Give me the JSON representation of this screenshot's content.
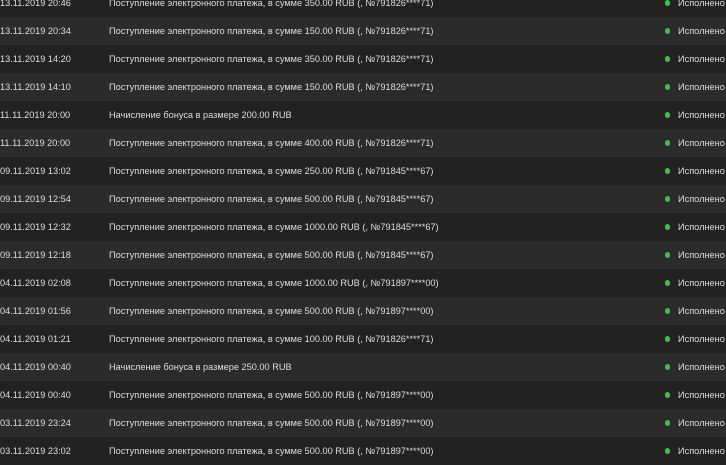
{
  "transactions": [
    {
      "date": "13.11.2019 20:46",
      "description": "Поступление электронного платежа, в сумме 350.00 RUB (, №791826****71)",
      "status": "Исполнено"
    },
    {
      "date": "13.11.2019 20:34",
      "description": "Поступление электронного платежа, в сумме 150.00 RUB (, №791826****71)",
      "status": "Исполнено"
    },
    {
      "date": "13.11.2019 14:20",
      "description": "Поступление электронного платежа, в сумме 350.00 RUB (, №791826****71)",
      "status": "Исполнено"
    },
    {
      "date": "13.11.2019 14:10",
      "description": "Поступление электронного платежа, в сумме 150.00 RUB (, №791826****71)",
      "status": "Исполнено"
    },
    {
      "date": "11.11.2019 20:00",
      "description": "Начисление бонуса в размере 200.00 RUB",
      "status": "Исполнено"
    },
    {
      "date": "11.11.2019 20:00",
      "description": "Поступление электронного платежа, в сумме 400.00 RUB (, №791826****71)",
      "status": "Исполнено"
    },
    {
      "date": "09.11.2019 13:02",
      "description": "Поступление электронного платежа, в сумме 250.00 RUB (, №791845****67)",
      "status": "Исполнено"
    },
    {
      "date": "09.11.2019 12:54",
      "description": "Поступление электронного платежа, в сумме 500.00 RUB (, №791845****67)",
      "status": "Исполнено"
    },
    {
      "date": "09.11.2019 12:32",
      "description": "Поступление электронного платежа, в сумме 1000.00 RUB (, №791845****67)",
      "status": "Исполнено"
    },
    {
      "date": "09.11.2019 12:18",
      "description": "Поступление электронного платежа, в сумме 500.00 RUB (, №791845****67)",
      "status": "Исполнено"
    },
    {
      "date": "04.11.2019 02:08",
      "description": "Поступление электронного платежа, в сумме 1000.00 RUB (, №791897****00)",
      "status": "Исполнено"
    },
    {
      "date": "04.11.2019 01:56",
      "description": "Поступление электронного платежа, в сумме 500.00 RUB (, №791897****00)",
      "status": "Исполнено"
    },
    {
      "date": "04.11.2019 01:21",
      "description": "Поступление электронного платежа, в сумме 100.00 RUB (, №791826****71)",
      "status": "Исполнено"
    },
    {
      "date": "04.11.2019 00:40",
      "description": "Начисление бонуса в размере 250.00 RUB",
      "status": "Исполнено"
    },
    {
      "date": "04.11.2019 00:40",
      "description": "Поступление электронного платежа, в сумме 500.00 RUB (, №791897****00)",
      "status": "Исполнено"
    },
    {
      "date": "03.11.2019 23:24",
      "description": "Поступление электронного платежа, в сумме 500.00 RUB (, №791897****00)",
      "status": "Исполнено"
    },
    {
      "date": "03.11.2019 23:02",
      "description": "Поступление электронного платежа, в сумме 500.00 RUB (, №791897****00)",
      "status": "Исполнено"
    }
  ],
  "colors": {
    "row_odd": "#222222",
    "row_even": "#2b2b2b",
    "text": "#dedede",
    "status_ok": "#3fbf4a"
  }
}
